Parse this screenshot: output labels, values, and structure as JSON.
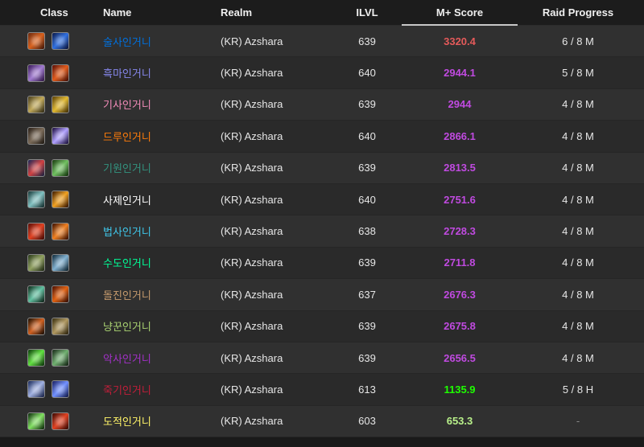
{
  "headers": {
    "class": "Class",
    "name": "Name",
    "realm": "Realm",
    "ilvl": "ILVL",
    "score": "M+ Score",
    "raid": "Raid Progress"
  },
  "rows": [
    {
      "name": "술사인거니",
      "name_color": "#0070dd",
      "realm": "(KR) Azshara",
      "ilvl": "639",
      "score": "3320.4",
      "score_color": "#e45a5a",
      "raid": "6 / 8 M",
      "icons": [
        {
          "name": "race-orc-icon",
          "bg": "linear-gradient(135deg,#6b2a10,#d8601c,#3a1408)"
        },
        {
          "name": "spec-enhancement-icon",
          "bg": "linear-gradient(135deg,#0c1a4a,#2f6fe0,#0a0f30)"
        }
      ]
    },
    {
      "name": "흑마인거니",
      "name_color": "#8788ee",
      "realm": "(KR) Azshara",
      "ilvl": "640",
      "score": "2944.1",
      "score_color": "#c04ae0",
      "raid": "5 / 8 M",
      "icons": [
        {
          "name": "race-voidelf-icon",
          "bg": "linear-gradient(135deg,#3a1a5a,#a07ad0,#2a1040)"
        },
        {
          "name": "spec-destruction-icon",
          "bg": "linear-gradient(135deg,#5a1008,#e05a1a,#3a0a04)"
        }
      ]
    },
    {
      "name": "기사인거니",
      "name_color": "#f48cba",
      "realm": "(KR) Azshara",
      "ilvl": "639",
      "score": "2944",
      "score_color": "#c04ae0",
      "raid": "4 / 8 M",
      "icons": [
        {
          "name": "race-human-icon",
          "bg": "linear-gradient(135deg,#4a4020,#c0a858,#2a2410)"
        },
        {
          "name": "spec-protection-icon",
          "bg": "linear-gradient(135deg,#5a4008,#e0b830,#3a2804)"
        }
      ]
    },
    {
      "name": "드루인거니",
      "name_color": "#ff7c0a",
      "realm": "(KR) Azshara",
      "ilvl": "640",
      "score": "2866.1",
      "score_color": "#c04ae0",
      "raid": "4 / 8 M",
      "icons": [
        {
          "name": "race-worgen-icon",
          "bg": "linear-gradient(135deg,#2a2018,#7a6a58,#1a140e)"
        },
        {
          "name": "spec-balance-icon",
          "bg": "linear-gradient(135deg,#1a0a3a,#b0a0ff,#120830)"
        }
      ]
    },
    {
      "name": "기원인거니",
      "name_color": "#33937f",
      "realm": "(KR) Azshara",
      "ilvl": "639",
      "score": "2813.5",
      "score_color": "#c04ae0",
      "raid": "4 / 8 M",
      "icons": [
        {
          "name": "race-dracthyr-icon",
          "bg": "linear-gradient(135deg,#1a2a5a,#d04040,#102040)"
        },
        {
          "name": "spec-preservation-icon",
          "bg": "linear-gradient(135deg,#1a3a10,#70c060,#0e2a08)"
        }
      ]
    },
    {
      "name": "사제인거니",
      "name_color": "#ffffff",
      "realm": "(KR) Azshara",
      "ilvl": "640",
      "score": "2751.6",
      "score_color": "#c04ae0",
      "raid": "4 / 8 M",
      "icons": [
        {
          "name": "race-undead-icon",
          "bg": "linear-gradient(135deg,#1a3a3a,#80c0c0,#0e2424)"
        },
        {
          "name": "spec-shadow-icon",
          "bg": "linear-gradient(135deg,#3a1a04,#f0a020,#2a0e02)"
        }
      ]
    },
    {
      "name": "법사인거니",
      "name_color": "#3fc7eb",
      "realm": "(KR) Azshara",
      "ilvl": "638",
      "score": "2728.3",
      "score_color": "#c04ae0",
      "raid": "4 / 8 M",
      "icons": [
        {
          "name": "race-bloodelf-icon",
          "bg": "linear-gradient(135deg,#5a0e08,#e04020,#3a0804)"
        },
        {
          "name": "spec-fire-icon",
          "bg": "linear-gradient(135deg,#3a1004,#f08020,#2a0802)"
        }
      ]
    },
    {
      "name": "수도인거니",
      "name_color": "#00ff98",
      "realm": "(KR) Azshara",
      "ilvl": "639",
      "score": "2711.8",
      "score_color": "#c04ae0",
      "raid": "4 / 8 M",
      "icons": [
        {
          "name": "race-pandaren-icon",
          "bg": "linear-gradient(135deg,#2a3a1a,#90a060,#1a2410)"
        },
        {
          "name": "spec-mistweaver-icon",
          "bg": "linear-gradient(135deg,#102a3a,#80b0d0,#081a24)"
        }
      ]
    },
    {
      "name": "돌진인거니",
      "name_color": "#c69b6d",
      "realm": "(KR) Azshara",
      "ilvl": "637",
      "score": "2676.3",
      "score_color": "#c04ae0",
      "raid": "4 / 8 M",
      "icons": [
        {
          "name": "race-nightelf-icon",
          "bg": "linear-gradient(135deg,#0e2a1a,#60c0a0,#081a10)"
        },
        {
          "name": "spec-fury-icon",
          "bg": "linear-gradient(135deg,#4a1004,#e06010,#2a0802)"
        }
      ]
    },
    {
      "name": "냥꾼인거니",
      "name_color": "#aad372",
      "realm": "(KR) Azshara",
      "ilvl": "639",
      "score": "2675.8",
      "score_color": "#c04ae0",
      "raid": "4 / 8 M",
      "icons": [
        {
          "name": "race-tauren-icon",
          "bg": "linear-gradient(135deg,#1a1004,#d06020,#100802)"
        },
        {
          "name": "spec-marksmanship-icon",
          "bg": "linear-gradient(135deg,#3a3010,#b09860,#241c08)"
        }
      ]
    },
    {
      "name": "악사인거니",
      "name_color": "#a330c9",
      "realm": "(KR) Azshara",
      "ilvl": "639",
      "score": "2656.5",
      "score_color": "#c04ae0",
      "raid": "4 / 8 M",
      "icons": [
        {
          "name": "race-demonhunter-icon",
          "bg": "linear-gradient(135deg,#0e3a0e,#60e040,#082a08)"
        },
        {
          "name": "spec-havoc-icon",
          "bg": "linear-gradient(135deg,#1a2a1a,#70b070,#0e1a0e)"
        }
      ]
    },
    {
      "name": "죽기인거니",
      "name_color": "#c41e3a",
      "realm": "(KR) Azshara",
      "ilvl": "613",
      "score": "1135.9",
      "score_color": "#1eff00",
      "raid": "5 / 8 H",
      "icons": [
        {
          "name": "race-human-dk-icon",
          "bg": "linear-gradient(135deg,#1a2a5a,#a0b0e0,#101a40)"
        },
        {
          "name": "spec-frost-icon",
          "bg": "linear-gradient(135deg,#1a2060,#7090ff,#0e1440)"
        }
      ]
    },
    {
      "name": "도적인거니",
      "name_color": "#fff468",
      "realm": "(KR) Azshara",
      "ilvl": "603",
      "score": "653.3",
      "score_color": "#b8f08a",
      "raid": "-",
      "icons": [
        {
          "name": "race-nightelf-rogue-icon",
          "bg": "linear-gradient(135deg,#0e2a0e,#80e060,#082008)"
        },
        {
          "name": "spec-outlaw-icon",
          "bg": "linear-gradient(135deg,#3a0a04,#e04020,#2a0602)"
        }
      ]
    }
  ]
}
